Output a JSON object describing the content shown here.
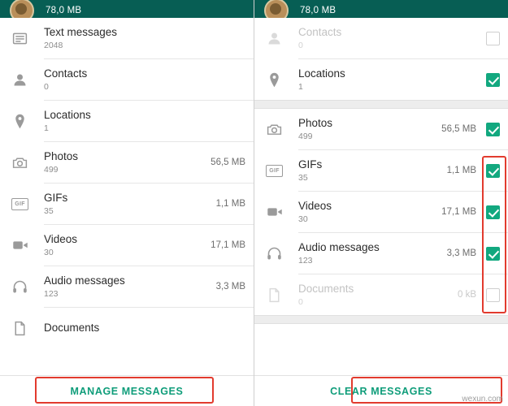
{
  "header": {
    "size_label": "78,0 MB",
    "ghost_label": "78,0 MB"
  },
  "left_screen": {
    "rows": [
      {
        "icon": "text-messages-icon",
        "title": "Text messages",
        "sub": "2048",
        "size": "",
        "checked": null
      },
      {
        "icon": "contacts-icon",
        "title": "Contacts",
        "sub": "0",
        "size": "",
        "checked": null
      },
      {
        "icon": "location-pin-icon",
        "title": "Locations",
        "sub": "1",
        "size": "",
        "checked": null
      },
      {
        "icon": "photos-camera-icon",
        "title": "Photos",
        "sub": "499",
        "size": "56,5 MB",
        "checked": null
      },
      {
        "icon": "gif-icon",
        "title": "GIFs",
        "sub": "35",
        "size": "1,1 MB",
        "checked": null
      },
      {
        "icon": "videos-camera-icon",
        "title": "Videos",
        "sub": "30",
        "size": "17,1 MB",
        "checked": null
      },
      {
        "icon": "audio-headphones-icon",
        "title": "Audio messages",
        "sub": "123",
        "size": "3,3 MB",
        "checked": null
      },
      {
        "icon": "documents-icon",
        "title": "Documents",
        "sub": "",
        "size": "",
        "checked": null
      }
    ],
    "bottom_button": "MANAGE MESSAGES"
  },
  "right_screen": {
    "rows": [
      {
        "icon": "contacts-icon",
        "title": "Contacts",
        "sub": "0",
        "size": "",
        "checked": false,
        "dim": true
      },
      {
        "icon": "location-pin-icon",
        "title": "Locations",
        "sub": "1",
        "size": "",
        "checked": true,
        "dim": false
      },
      {
        "icon": "photos-camera-icon",
        "title": "Photos",
        "sub": "499",
        "size": "56,5 MB",
        "checked": true,
        "dim": false
      },
      {
        "icon": "gif-icon",
        "title": "GIFs",
        "sub": "35",
        "size": "1,1 MB",
        "checked": true,
        "dim": false
      },
      {
        "icon": "videos-camera-icon",
        "title": "Videos",
        "sub": "30",
        "size": "17,1 MB",
        "checked": true,
        "dim": false
      },
      {
        "icon": "audio-headphones-icon",
        "title": "Audio messages",
        "sub": "123",
        "size": "3,3 MB",
        "checked": true,
        "dim": false
      },
      {
        "icon": "documents-icon",
        "title": "Documents",
        "sub": "0",
        "size": "0 kB",
        "checked": false,
        "dim": true
      }
    ],
    "bottom_button": "CLEAR MESSAGES"
  },
  "watermark": "wexun.com",
  "colors": {
    "header_teal": "#075e54",
    "accent_green": "#12a87f",
    "highlight_red": "#e23b2e",
    "muted_text": "#8d8d8d"
  }
}
